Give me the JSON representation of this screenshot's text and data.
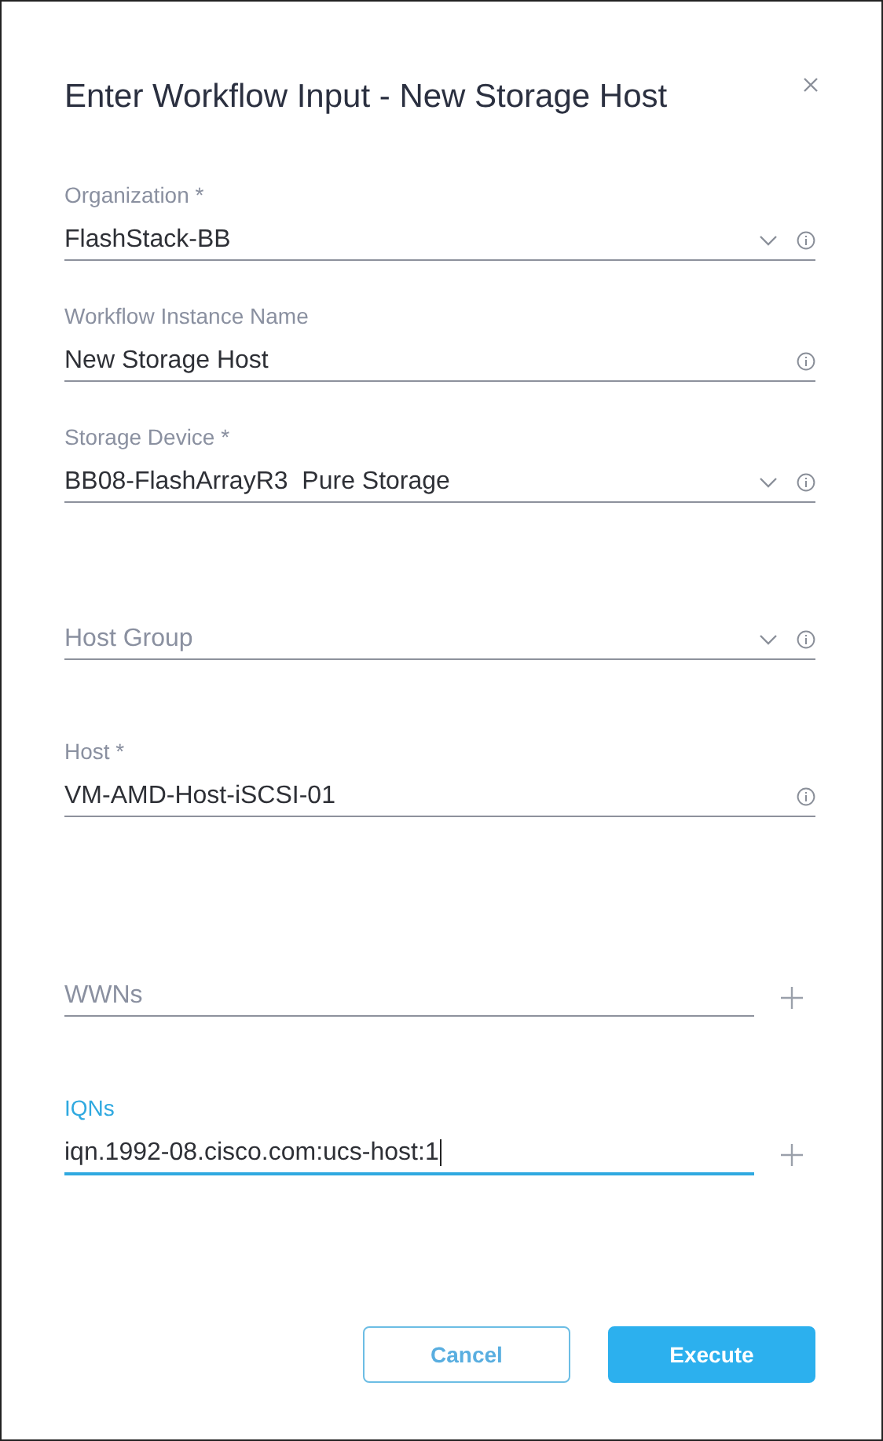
{
  "dialog": {
    "title": "Enter Workflow Input - New Storage Host"
  },
  "fields": [
    {
      "kind": "select",
      "label": "Organization *",
      "value": "FlashStack-BB",
      "focused": false
    },
    {
      "kind": "text",
      "label": "Workflow Instance Name",
      "value": "New Storage Host",
      "focused": false
    },
    {
      "kind": "select",
      "label": "Storage Device *",
      "value": "BB08-FlashArrayR3  Pure Storage",
      "focused": false
    },
    {
      "kind": "select",
      "placeholder": "Host Group",
      "focused": false
    },
    {
      "kind": "text",
      "label": "Host *",
      "value": "VM-AMD-Host-iSCSI-01",
      "focused": false
    },
    {
      "kind": "list",
      "placeholder": "WWNs",
      "focused": false
    },
    {
      "kind": "list",
      "label": "IQNs",
      "value": "iqn.1992-08.cisco.com:ucs-host:1",
      "focused": true
    }
  ],
  "buttons": [
    {
      "kind": "secondary",
      "label": "Cancel"
    },
    {
      "kind": "primary",
      "label": "Execute"
    }
  ]
}
